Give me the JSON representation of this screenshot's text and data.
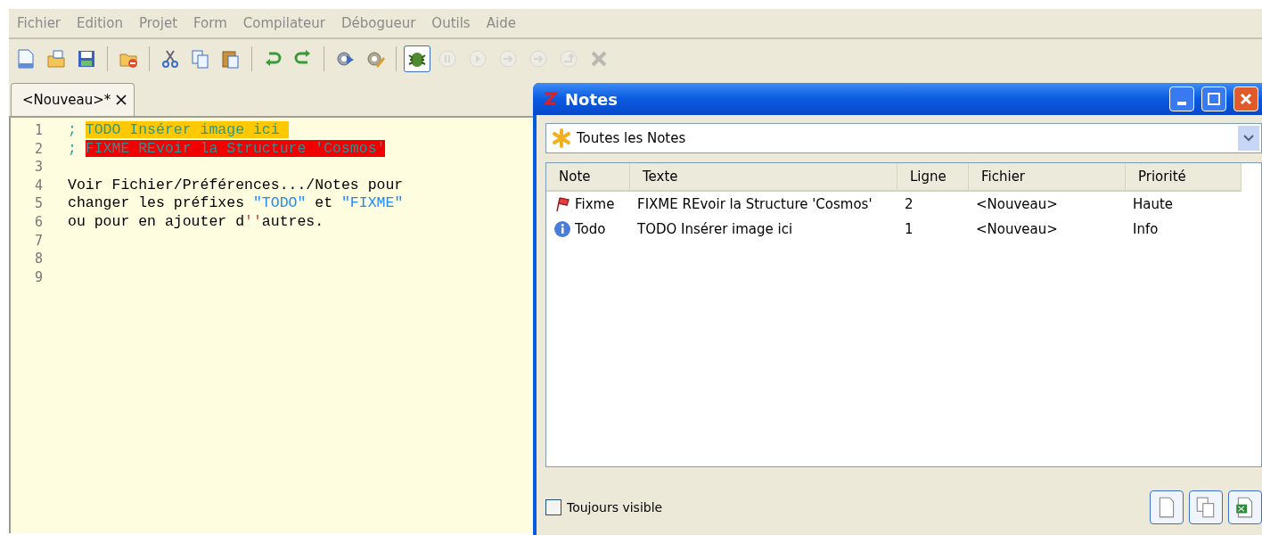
{
  "menu": [
    "Fichier",
    "Edition",
    "Projet",
    "Form",
    "Compilateur",
    "Débogueur",
    "Outils",
    "Aide"
  ],
  "toolbar": [
    {
      "kind": "new",
      "disabled": false
    },
    {
      "kind": "open",
      "disabled": false
    },
    {
      "kind": "save",
      "disabled": false
    },
    {
      "kind": "sep"
    },
    {
      "kind": "close-file",
      "disabled": false
    },
    {
      "kind": "sep"
    },
    {
      "kind": "cut",
      "disabled": false
    },
    {
      "kind": "copy",
      "disabled": false
    },
    {
      "kind": "paste",
      "disabled": false
    },
    {
      "kind": "sep"
    },
    {
      "kind": "undo",
      "disabled": false
    },
    {
      "kind": "redo",
      "disabled": false
    },
    {
      "kind": "sep"
    },
    {
      "kind": "compile",
      "disabled": false
    },
    {
      "kind": "options",
      "disabled": false
    },
    {
      "kind": "sep"
    },
    {
      "kind": "debug",
      "disabled": false
    },
    {
      "kind": "pause",
      "disabled": true
    },
    {
      "kind": "play",
      "disabled": true
    },
    {
      "kind": "step",
      "disabled": true
    },
    {
      "kind": "step",
      "disabled": true
    },
    {
      "kind": "step-out",
      "disabled": true
    },
    {
      "kind": "stop",
      "disabled": true
    }
  ],
  "tabs": [
    {
      "label": "<Nouveau>*",
      "selected": true
    }
  ],
  "editor": {
    "lines": [
      {
        "number": "1",
        "segments": [
          {
            "kind": "comment",
            "text": "; "
          },
          {
            "kind": "todo",
            "text": "TODO Insérer image ici "
          }
        ]
      },
      {
        "number": "2",
        "segments": [
          {
            "kind": "comment",
            "text": "; "
          },
          {
            "kind": "fixme",
            "text": "FIXME REvoir la Structure 'Cosmos'"
          }
        ]
      },
      {
        "number": "3"
      },
      {
        "number": "4",
        "segments": [
          {
            "kind": "text",
            "text": "Voir Fichier/Préférences.../Notes pour"
          }
        ]
      },
      {
        "number": "5",
        "segments": [
          {
            "kind": "text",
            "text": "changer les préfixes "
          },
          {
            "kind": "string",
            "text": "\"TODO\""
          },
          {
            "kind": "text",
            "text": " et "
          },
          {
            "kind": "string",
            "text": "\"FIXME\""
          }
        ]
      },
      {
        "number": "6",
        "segments": [
          {
            "kind": "text",
            "text": "ou pour en ajouter d"
          },
          {
            "kind": "quote",
            "text": "''"
          },
          {
            "kind": "text",
            "text": "autres."
          }
        ]
      },
      {
        "number": "7"
      },
      {
        "number": "8"
      },
      {
        "number": "9"
      }
    ]
  },
  "notes_window": {
    "title": "Notes",
    "filter": "Toutes les Notes",
    "columns": [
      "Note",
      "Texte",
      "Ligne",
      "Fichier",
      "Priorité"
    ],
    "rows": [
      {
        "kind": "fixme",
        "note": "Fixme",
        "text": "FIXME REvoir la Structure 'Cosmos'",
        "line": "2",
        "file": "<Nouveau>",
        "priority": "Haute"
      },
      {
        "kind": "todo",
        "note": "Todo",
        "text": "TODO Insérer image ici",
        "line": "1",
        "file": "<Nouveau>",
        "priority": "Info"
      }
    ],
    "always_visible": {
      "label": "Toujours visible",
      "checked": false
    },
    "buttons": [
      {
        "kind": "new"
      },
      {
        "kind": "copy"
      },
      {
        "kind": "export"
      }
    ]
  }
}
